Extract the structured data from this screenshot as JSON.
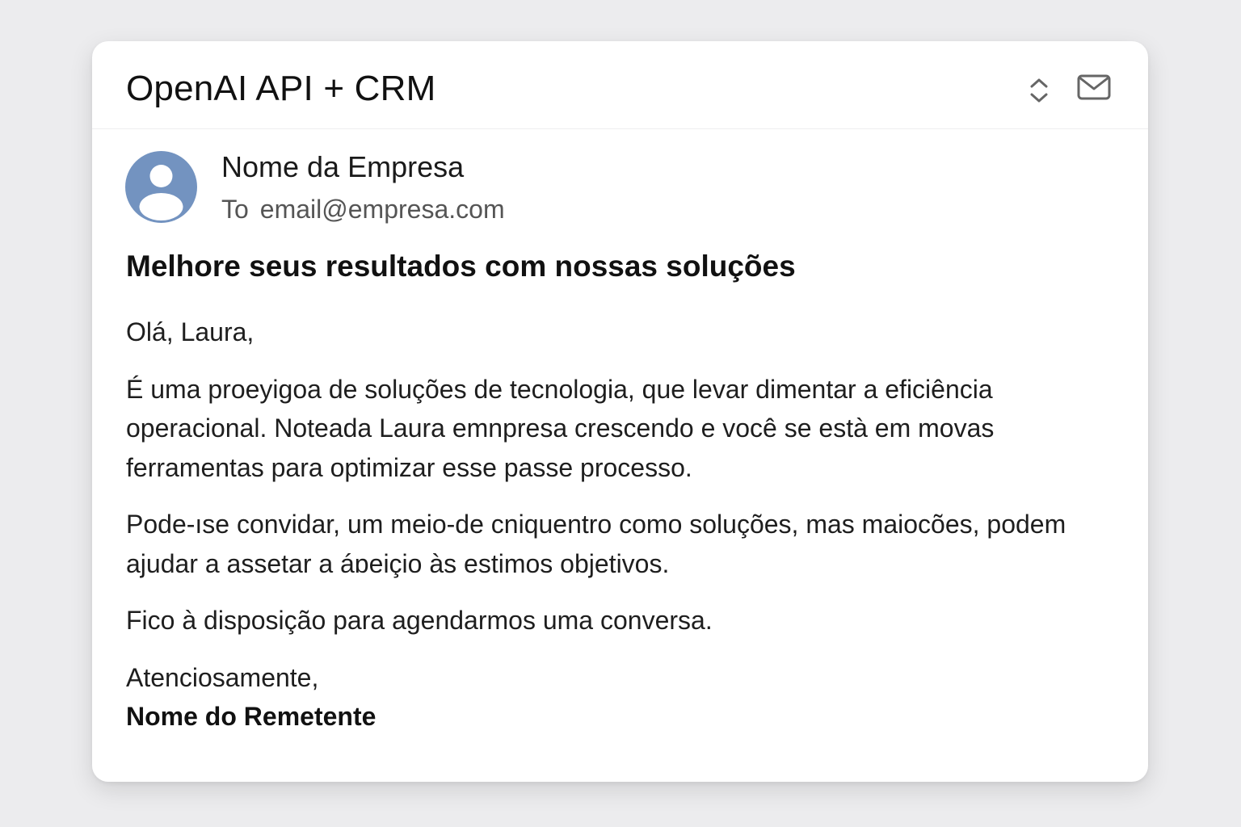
{
  "window": {
    "title": "OpenAI API + CRM",
    "icons": [
      "sort-icon",
      "mail-icon"
    ]
  },
  "email": {
    "sender_name": "Nome da Empresa",
    "to_label": "To",
    "to_address": "email@empresa.com",
    "subject": "Melhore seus resultados com nossas soluções",
    "greeting": "Olá, Laura,",
    "paragraphs": [
      "É uma proeyigoa de soluções de tecnologia, que levar dimentar a eficiência operacional. Noteada Laura emnpresa crescendo e você se està em movas ferramentas para optimizar esse passe processo.",
      "Pode-ıse convidar, um meio-de cniquentro como soluções, mas maiocões, podem ajudar a assetar a áɒeiçio às estimos objetivos.",
      "Fico à disposição para agendarmos uma conversa."
    ],
    "closing": "Atenciosamente,",
    "signature": "Nome do Remetente"
  },
  "colors": {
    "background": "#ececee",
    "card": "#ffffff",
    "avatar": "#7393c0",
    "icon": "#666666"
  }
}
